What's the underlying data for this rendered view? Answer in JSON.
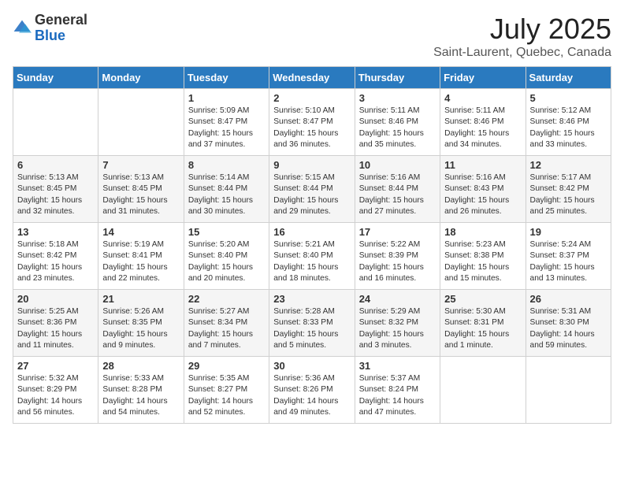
{
  "header": {
    "logo_general": "General",
    "logo_blue": "Blue",
    "month": "July 2025",
    "location": "Saint-Laurent, Quebec, Canada"
  },
  "weekdays": [
    "Sunday",
    "Monday",
    "Tuesday",
    "Wednesday",
    "Thursday",
    "Friday",
    "Saturday"
  ],
  "weeks": [
    [
      {
        "day": "",
        "lines": []
      },
      {
        "day": "",
        "lines": []
      },
      {
        "day": "1",
        "lines": [
          "Sunrise: 5:09 AM",
          "Sunset: 8:47 PM",
          "Daylight: 15 hours",
          "and 37 minutes."
        ]
      },
      {
        "day": "2",
        "lines": [
          "Sunrise: 5:10 AM",
          "Sunset: 8:47 PM",
          "Daylight: 15 hours",
          "and 36 minutes."
        ]
      },
      {
        "day": "3",
        "lines": [
          "Sunrise: 5:11 AM",
          "Sunset: 8:46 PM",
          "Daylight: 15 hours",
          "and 35 minutes."
        ]
      },
      {
        "day": "4",
        "lines": [
          "Sunrise: 5:11 AM",
          "Sunset: 8:46 PM",
          "Daylight: 15 hours",
          "and 34 minutes."
        ]
      },
      {
        "day": "5",
        "lines": [
          "Sunrise: 5:12 AM",
          "Sunset: 8:46 PM",
          "Daylight: 15 hours",
          "and 33 minutes."
        ]
      }
    ],
    [
      {
        "day": "6",
        "lines": [
          "Sunrise: 5:13 AM",
          "Sunset: 8:45 PM",
          "Daylight: 15 hours",
          "and 32 minutes."
        ]
      },
      {
        "day": "7",
        "lines": [
          "Sunrise: 5:13 AM",
          "Sunset: 8:45 PM",
          "Daylight: 15 hours",
          "and 31 minutes."
        ]
      },
      {
        "day": "8",
        "lines": [
          "Sunrise: 5:14 AM",
          "Sunset: 8:44 PM",
          "Daylight: 15 hours",
          "and 30 minutes."
        ]
      },
      {
        "day": "9",
        "lines": [
          "Sunrise: 5:15 AM",
          "Sunset: 8:44 PM",
          "Daylight: 15 hours",
          "and 29 minutes."
        ]
      },
      {
        "day": "10",
        "lines": [
          "Sunrise: 5:16 AM",
          "Sunset: 8:44 PM",
          "Daylight: 15 hours",
          "and 27 minutes."
        ]
      },
      {
        "day": "11",
        "lines": [
          "Sunrise: 5:16 AM",
          "Sunset: 8:43 PM",
          "Daylight: 15 hours",
          "and 26 minutes."
        ]
      },
      {
        "day": "12",
        "lines": [
          "Sunrise: 5:17 AM",
          "Sunset: 8:42 PM",
          "Daylight: 15 hours",
          "and 25 minutes."
        ]
      }
    ],
    [
      {
        "day": "13",
        "lines": [
          "Sunrise: 5:18 AM",
          "Sunset: 8:42 PM",
          "Daylight: 15 hours",
          "and 23 minutes."
        ]
      },
      {
        "day": "14",
        "lines": [
          "Sunrise: 5:19 AM",
          "Sunset: 8:41 PM",
          "Daylight: 15 hours",
          "and 22 minutes."
        ]
      },
      {
        "day": "15",
        "lines": [
          "Sunrise: 5:20 AM",
          "Sunset: 8:40 PM",
          "Daylight: 15 hours",
          "and 20 minutes."
        ]
      },
      {
        "day": "16",
        "lines": [
          "Sunrise: 5:21 AM",
          "Sunset: 8:40 PM",
          "Daylight: 15 hours",
          "and 18 minutes."
        ]
      },
      {
        "day": "17",
        "lines": [
          "Sunrise: 5:22 AM",
          "Sunset: 8:39 PM",
          "Daylight: 15 hours",
          "and 16 minutes."
        ]
      },
      {
        "day": "18",
        "lines": [
          "Sunrise: 5:23 AM",
          "Sunset: 8:38 PM",
          "Daylight: 15 hours",
          "and 15 minutes."
        ]
      },
      {
        "day": "19",
        "lines": [
          "Sunrise: 5:24 AM",
          "Sunset: 8:37 PM",
          "Daylight: 15 hours",
          "and 13 minutes."
        ]
      }
    ],
    [
      {
        "day": "20",
        "lines": [
          "Sunrise: 5:25 AM",
          "Sunset: 8:36 PM",
          "Daylight: 15 hours",
          "and 11 minutes."
        ]
      },
      {
        "day": "21",
        "lines": [
          "Sunrise: 5:26 AM",
          "Sunset: 8:35 PM",
          "Daylight: 15 hours",
          "and 9 minutes."
        ]
      },
      {
        "day": "22",
        "lines": [
          "Sunrise: 5:27 AM",
          "Sunset: 8:34 PM",
          "Daylight: 15 hours",
          "and 7 minutes."
        ]
      },
      {
        "day": "23",
        "lines": [
          "Sunrise: 5:28 AM",
          "Sunset: 8:33 PM",
          "Daylight: 15 hours",
          "and 5 minutes."
        ]
      },
      {
        "day": "24",
        "lines": [
          "Sunrise: 5:29 AM",
          "Sunset: 8:32 PM",
          "Daylight: 15 hours",
          "and 3 minutes."
        ]
      },
      {
        "day": "25",
        "lines": [
          "Sunrise: 5:30 AM",
          "Sunset: 8:31 PM",
          "Daylight: 15 hours",
          "and 1 minute."
        ]
      },
      {
        "day": "26",
        "lines": [
          "Sunrise: 5:31 AM",
          "Sunset: 8:30 PM",
          "Daylight: 14 hours",
          "and 59 minutes."
        ]
      }
    ],
    [
      {
        "day": "27",
        "lines": [
          "Sunrise: 5:32 AM",
          "Sunset: 8:29 PM",
          "Daylight: 14 hours",
          "and 56 minutes."
        ]
      },
      {
        "day": "28",
        "lines": [
          "Sunrise: 5:33 AM",
          "Sunset: 8:28 PM",
          "Daylight: 14 hours",
          "and 54 minutes."
        ]
      },
      {
        "day": "29",
        "lines": [
          "Sunrise: 5:35 AM",
          "Sunset: 8:27 PM",
          "Daylight: 14 hours",
          "and 52 minutes."
        ]
      },
      {
        "day": "30",
        "lines": [
          "Sunrise: 5:36 AM",
          "Sunset: 8:26 PM",
          "Daylight: 14 hours",
          "and 49 minutes."
        ]
      },
      {
        "day": "31",
        "lines": [
          "Sunrise: 5:37 AM",
          "Sunset: 8:24 PM",
          "Daylight: 14 hours",
          "and 47 minutes."
        ]
      },
      {
        "day": "",
        "lines": []
      },
      {
        "day": "",
        "lines": []
      }
    ]
  ]
}
